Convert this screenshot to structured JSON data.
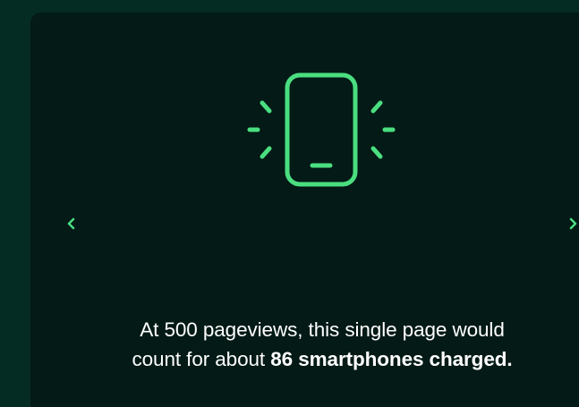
{
  "slide": {
    "icon": "vibrating-smartphone-icon",
    "accent_color": "#4ade80",
    "caption_line1": "At 500 pageviews, this single page would",
    "caption_line2_prefix": "count for about ",
    "caption_line2_emphasis": "86 smartphones charged."
  },
  "navigation": {
    "prev_icon": "chevron-left-icon",
    "next_icon": "chevron-right-icon"
  },
  "colors": {
    "page_background": "#052c22",
    "card_background": "#031a16",
    "text": "#ffffff"
  }
}
